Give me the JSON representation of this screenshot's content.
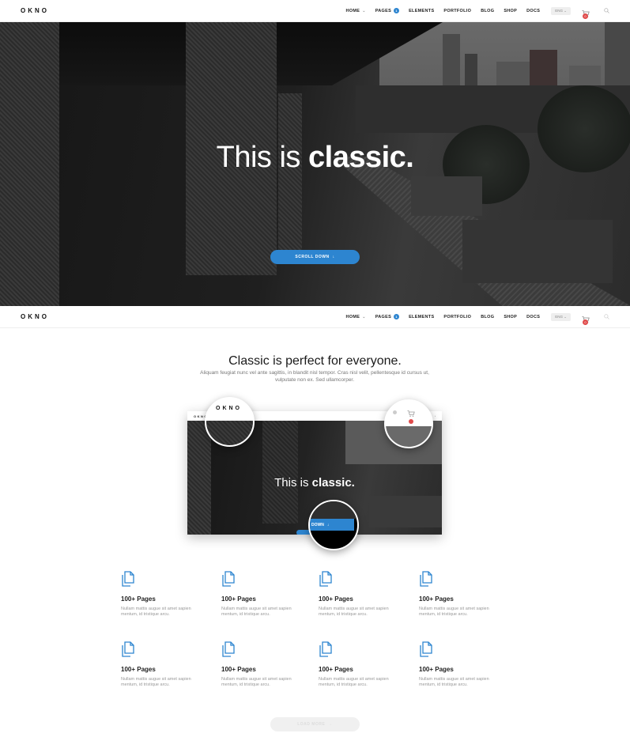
{
  "nav": {
    "logo": "OKNO",
    "items": [
      {
        "label": "HOME",
        "has_chevron": true
      },
      {
        "label": "PAGES",
        "badge": "1"
      },
      {
        "label": "ELEMENTS"
      },
      {
        "label": "PORTFOLIO"
      },
      {
        "label": "BLOG"
      },
      {
        "label": "SHOP"
      },
      {
        "label": "DOCS"
      }
    ],
    "language": "ENG",
    "cart_count": "0"
  },
  "hero": {
    "title_light": "This is ",
    "title_bold": "classic.",
    "button_label": "SCROLL DOWN"
  },
  "intro": {
    "title": "Classic is perfect for everyone.",
    "description": "Aliquam feugiat nunc vel ante sagittis, in blandit nisl tempor. Cras nisl velit, pellentesque id cursus ut, vulputate non ex. Sed ullamcorper."
  },
  "mockup": {
    "logo": "OKNO",
    "title_light": "This is ",
    "title_bold": "classic.",
    "lens_logo": "OKNO",
    "lens_button": "DOWN"
  },
  "features": [
    {
      "title": "100+ Pages",
      "text": "Nullam mattis augue sit amet sapien mentum, id tristique arcu."
    },
    {
      "title": "100+ Pages",
      "text": "Nullam mattis augue sit amet sapien mentum, id tristique arcu."
    },
    {
      "title": "100+ Pages",
      "text": "Nullam mattis augue sit amet sapien mentum, id tristique arcu."
    },
    {
      "title": "100+ Pages",
      "text": "Nullam mattis augue sit amet sapien mentum, id tristique arcu."
    },
    {
      "title": "100+ Pages",
      "text": "Nullam mattis augue sit amet sapien mentum, id tristique arcu."
    },
    {
      "title": "100+ Pages",
      "text": "Nullam mattis augue sit amet sapien mentum, id tristique arcu."
    },
    {
      "title": "100+ Pages",
      "text": "Nullam mattis augue sit amet sapien mentum, id tristique arcu."
    },
    {
      "title": "100+ Pages",
      "text": "Nullam mattis augue sit amet sapien mentum, id tristique arcu."
    }
  ],
  "load_more_label": "LOAD MORE",
  "colors": {
    "accent": "#2d85d0",
    "cart_badge": "#e04b4b"
  }
}
